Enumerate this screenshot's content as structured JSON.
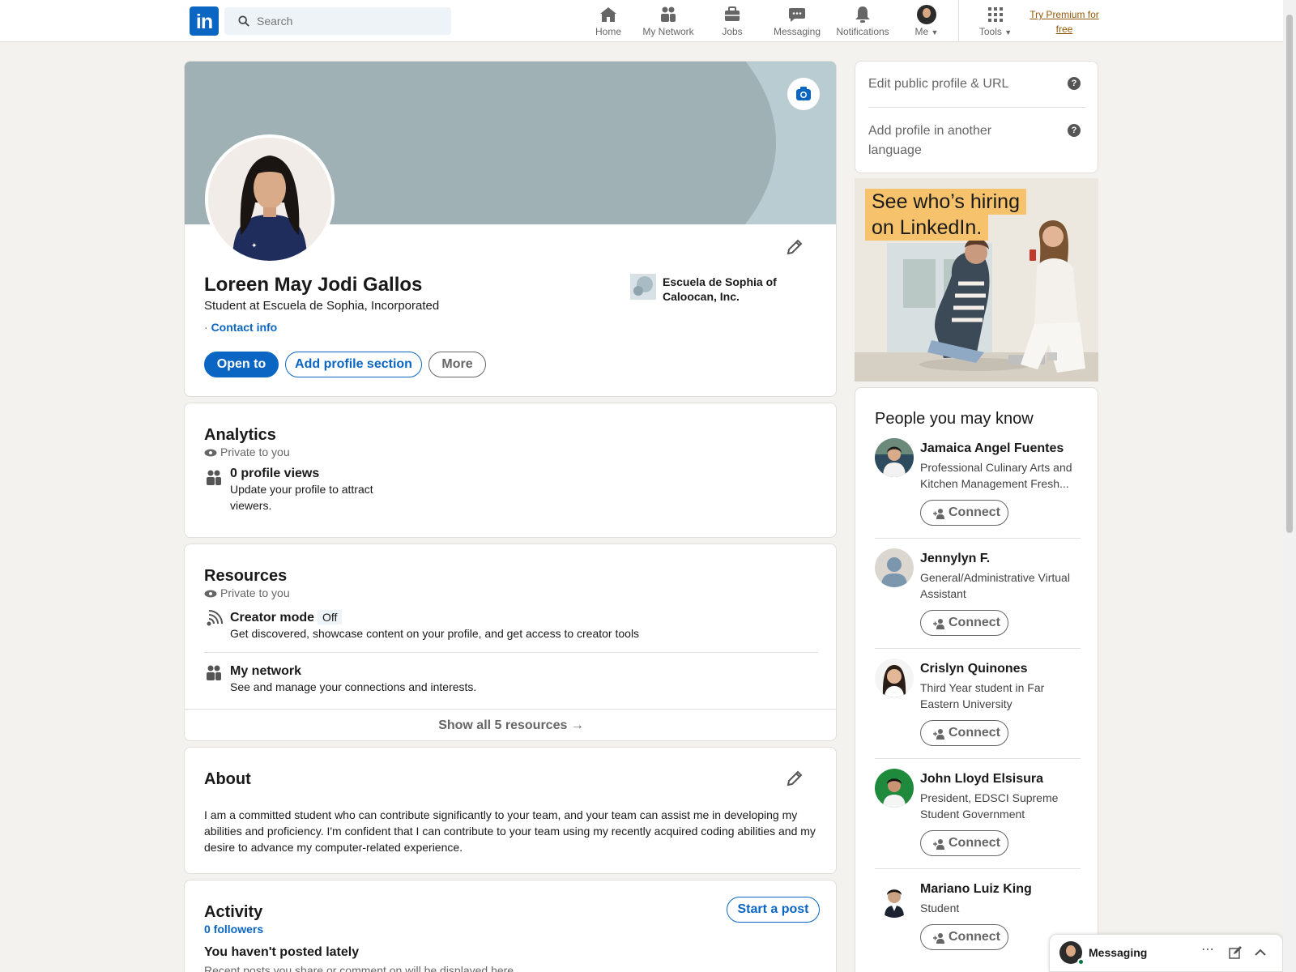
{
  "nav": {
    "logo": "in",
    "search_placeholder": "Search",
    "items": [
      {
        "label": "Home",
        "icon": "home-icon"
      },
      {
        "label": "My Network",
        "icon": "network-icon"
      },
      {
        "label": "Jobs",
        "icon": "briefcase-icon"
      },
      {
        "label": "Messaging",
        "icon": "chat-icon"
      },
      {
        "label": "Notifications",
        "icon": "bell-icon"
      },
      {
        "label": "Me",
        "icon": "avatar"
      },
      {
        "label": "Tools",
        "icon": "grid-icon"
      }
    ],
    "premium": "Try Premium for free"
  },
  "profile": {
    "name": "Loreen May Jodi Gallos",
    "headline": "Student at Escuela de Sophia, Incorporated",
    "contact_prefix": "·",
    "contact_label": "Contact info",
    "school": "Escuela de Sophia of Caloocan, Inc.",
    "buttons": {
      "open_to": "Open to",
      "add_section": "Add profile section",
      "more": "More"
    }
  },
  "analytics": {
    "title": "Analytics",
    "private": "Private to you",
    "views_title": "0 profile views",
    "views_desc": "Update your profile to attract viewers."
  },
  "resources": {
    "title": "Resources",
    "private": "Private to you",
    "creator_title": "Creator mode",
    "creator_badge": "Off",
    "creator_desc": "Get discovered, showcase content on your profile, and get access to creator tools",
    "network_title": "My network",
    "network_desc": "See and manage your connections and interests.",
    "show_all": "Show all 5 resources →"
  },
  "about": {
    "title": "About",
    "text": "I am a committed student who can contribute significantly to your team, and your team can assist me in developing my abilities and proficiency. I'm confident that I can contribute to your team using my recently acquired coding abilities and my desire to advance my computer-related experience."
  },
  "activity": {
    "title": "Activity",
    "followers": "0 followers",
    "start_post": "Start a post",
    "empty_title": "You haven't posted lately",
    "empty_desc": "Recent posts you share or comment on will be displayed here."
  },
  "sidebar": {
    "edit_public": "Edit public profile & URL",
    "add_language": "Add profile in another language",
    "ad_line1": "See who’s hiring",
    "ad_line2": "on LinkedIn."
  },
  "pymk": {
    "title": "People you may know",
    "connect_label": "Connect",
    "people": [
      {
        "name": "Jamaica Angel Fuentes",
        "desc": "Professional Culinary Arts and Kitchen Management Fresh..."
      },
      {
        "name": "Jennylyn F.",
        "desc": "General/Administrative Virtual Assistant"
      },
      {
        "name": "Crislyn Quinones",
        "desc": "Third Year student in Far Eastern University"
      },
      {
        "name": "John Lloyd Elsisura",
        "desc": "President, EDSCI Supreme Student Government"
      },
      {
        "name": "Mariano Luiz King",
        "desc": "Student"
      }
    ]
  },
  "messaging": {
    "label": "Messaging"
  },
  "colors": {
    "brand": "#0a66c2",
    "page_bg": "#f3f2ef",
    "premium": "#915907"
  }
}
